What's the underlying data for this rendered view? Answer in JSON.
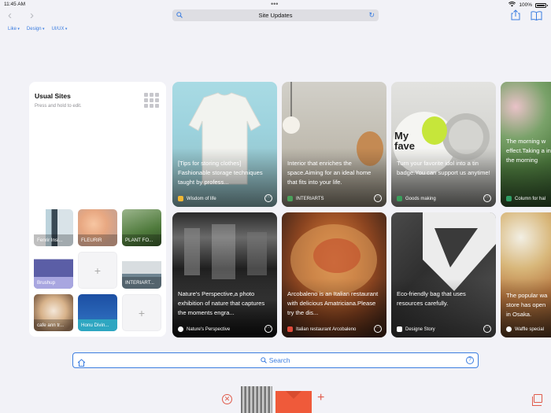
{
  "status": {
    "time": "11:45 AM",
    "battery": "100%"
  },
  "address_bar": {
    "title": "Site Updates"
  },
  "filters": [
    "Like",
    "Design",
    "UI/UX"
  ],
  "usual_sites": {
    "title": "Usual Sites",
    "hint": "Press and hold to edit.",
    "tiles": [
      {
        "label": "Fenrir Insi..."
      },
      {
        "label": "FLEURIR"
      },
      {
        "label": "PLANT FO..."
      },
      {
        "label": "Brushup"
      },
      {
        "label": ""
      },
      {
        "label": "INTERIART..."
      },
      {
        "label": "cafe ann tr..."
      },
      {
        "label": "Honu Divin..."
      },
      {
        "label": ""
      }
    ]
  },
  "cards": [
    {
      "title": "[Tips for storing clothes] Fashionable storage techniques taught by profess...",
      "source": "Wisdom of life"
    },
    {
      "title": "Interior that enriches the space.Aiming for an ideal home that fits into your life.",
      "source": "INTERIARTS"
    },
    {
      "title": "Turn your favorite idol into a tin badge.You can support us anytime!",
      "source": "Goods making"
    },
    {
      "title": "The morning w effect.Taking a in the morning",
      "source": "Column for hal"
    },
    {
      "title": "Nature's Perspective,a photo exhibition of nature that captures the moments engra...",
      "source": "Nature's Perspective"
    },
    {
      "title": "Arcobaleno is an Italian restaurant with delicious Amatriciana.Please try the dis...",
      "source": "Italian restaurant Arcobaleno"
    },
    {
      "title": "Eco-friendly bag that uses resources carefully.",
      "source": "Designe Story"
    },
    {
      "title": "The popular wa store has open in Osaka.",
      "source": "Waffle special"
    }
  ],
  "card_badge_text": "My fave",
  "search_bar": {
    "label": "Search",
    "help_symbol": "?"
  },
  "tab_bar": {
    "close_symbol": "✕",
    "add_symbol": "+"
  },
  "colors": {
    "accent": "#3b7de0",
    "tab_accent": "#e05a4a",
    "background": "#f2f2f7"
  }
}
